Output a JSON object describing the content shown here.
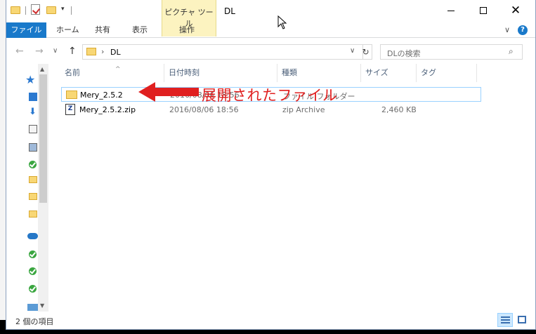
{
  "titlebar": {
    "contextual_tab_group": "ピクチャ ツール",
    "window_title": "DL",
    "controls": {
      "minimize_icon": "minimize-icon",
      "maximize_icon": "maximize-icon",
      "close_icon": "close-icon"
    }
  },
  "ribbon": {
    "tabs": [
      {
        "label": "ファイル"
      },
      {
        "label": "ホーム"
      },
      {
        "label": "共有"
      },
      {
        "label": "表示"
      },
      {
        "label": "操作"
      }
    ],
    "collapse_glyph": "∨",
    "help_glyph": "?"
  },
  "navigation": {
    "back_glyph": "←",
    "forward_glyph": "→",
    "history_glyph": "∨",
    "up_glyph": "↑",
    "address_separator": "›",
    "address_path": "DL",
    "address_dropdown_glyph": "∨",
    "refresh_glyph": "↻",
    "search_placeholder": "DLの検索",
    "search_icon_glyph": "⌕"
  },
  "navpane": {
    "quick_access_icon": "star-icon"
  },
  "filelist": {
    "columns": [
      "名前",
      "日付時刻",
      "種類",
      "サイズ",
      "タグ"
    ],
    "sort_caret": "^",
    "rows": [
      {
        "name": "Mery_2.5.2",
        "date": "2016/08/06 18:56",
        "type": "ファイル フォルダー",
        "size": "",
        "icon": "folder-icon",
        "selected": true
      },
      {
        "name": "Mery_2.5.2.zip",
        "date": "2016/08/06 18:56",
        "type": "zip Archive",
        "size": "2,460 KB",
        "icon": "zip-file-icon",
        "selected": false
      }
    ]
  },
  "annotation": {
    "text": "展開されたファイル",
    "color": "#e02020"
  },
  "statusbar": {
    "item_count": "2 個の項目"
  },
  "colors": {
    "file_tab": "#1979ca",
    "context_tab_bg": "#fcf3c0",
    "folder": "#f8d775",
    "selection_border": "#99d1ff"
  }
}
